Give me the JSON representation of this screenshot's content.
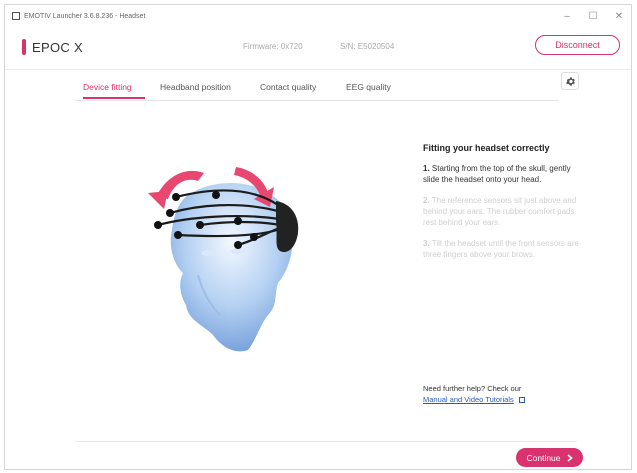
{
  "window": {
    "title": "EMOTIV Launcher 3.6.8.236 - Headset",
    "controls": {
      "minimize": "–",
      "maximize": "☐",
      "close": "✕"
    }
  },
  "header": {
    "device_name": "EPOC X",
    "firmware": "Firmware: 0x720",
    "serial": "S/N: E5020504",
    "disconnect_label": "Disconnect"
  },
  "tabs": [
    {
      "label": "Device fitting",
      "active": true
    },
    {
      "label": "Headband position",
      "active": false
    },
    {
      "label": "Contact quality",
      "active": false
    },
    {
      "label": "EEG quality",
      "active": false
    }
  ],
  "settings": {
    "icon": "gear-icon"
  },
  "instructions": {
    "title": "Fitting your headset correctly",
    "steps": [
      {
        "number": "1.",
        "text": "Starting from the top of the skull, gently slide the headset onto your head.",
        "current": true
      },
      {
        "number": "2.",
        "text": "The reference sensors sit just above and behind your ears. The rubber comfort pads rest behind your ears.",
        "current": false
      },
      {
        "number": "3.",
        "text": "Tilt the headset until the front sensors are three fingers above your brows.",
        "current": false
      }
    ]
  },
  "help": {
    "prompt": "Need further help? Check our",
    "link_text": "Manual and Video Tutorials",
    "link_icon": "external-link-icon"
  },
  "footer": {
    "continue_label": "Continue",
    "continue_icon": "chevron-right-icon"
  },
  "colors": {
    "accent": "#d8326f",
    "link": "#2b5db8",
    "head": "#8fb6e6"
  }
}
